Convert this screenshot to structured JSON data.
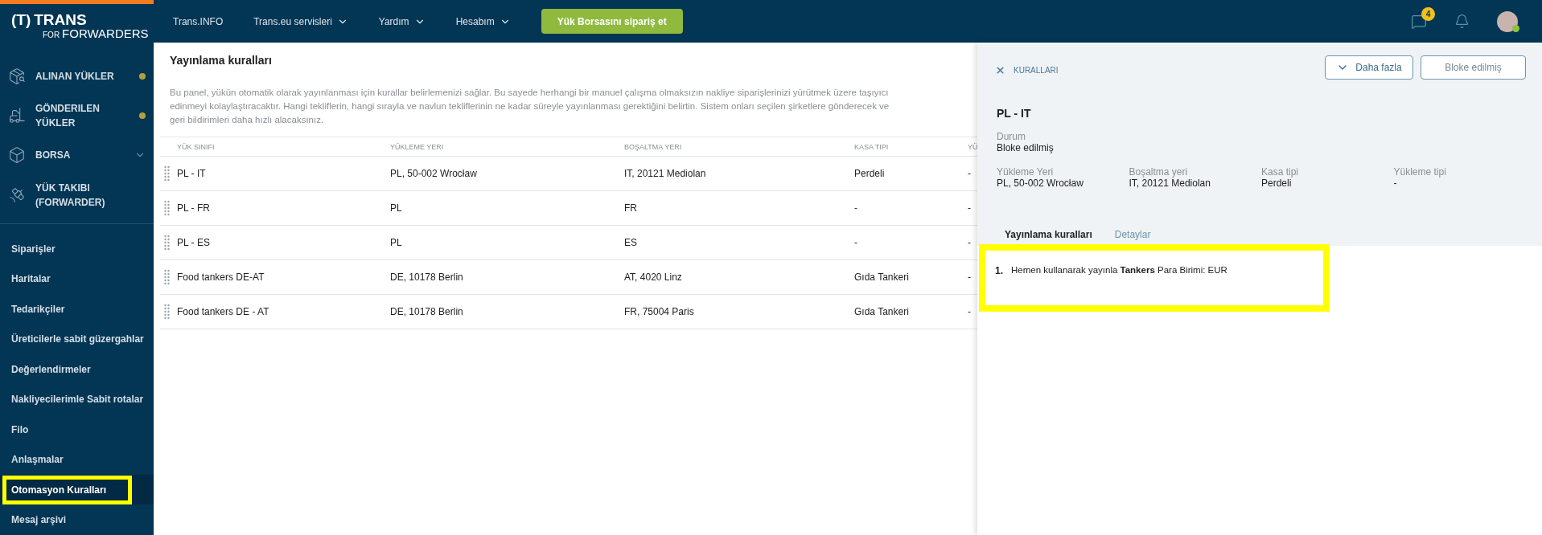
{
  "logo": {
    "mark": "(T)",
    "name": "TRANS",
    "prefix": "FOR",
    "tagline": "FORWARDERS"
  },
  "top_nav": [
    {
      "label": "Trans.INFO",
      "dropdown": false
    },
    {
      "label": "Trans.eu servisleri",
      "dropdown": true
    },
    {
      "label": "Yardım",
      "dropdown": true
    },
    {
      "label": "Hesabım",
      "dropdown": true
    }
  ],
  "order_button": "Yük Borsasını sipariş et",
  "messages_badge": "4",
  "sidebar": {
    "modules": [
      {
        "label": "ALINAN YÜKLER",
        "indicator": true,
        "dropdown": false
      },
      {
        "label": "GÖNDERILEN YÜKLER",
        "indicator": true,
        "dropdown": false
      },
      {
        "label": "BORSA",
        "indicator": false,
        "dropdown": true
      },
      {
        "label": "YÜK TAKIBI (FORWARDER)",
        "indicator": false,
        "dropdown": false
      }
    ],
    "links": [
      {
        "label": "Siparişler",
        "selected": false,
        "highlighted": false
      },
      {
        "label": "Haritalar",
        "selected": false,
        "highlighted": false
      },
      {
        "label": "Tedarikçiler",
        "selected": false,
        "highlighted": false
      },
      {
        "label": "Üreticilerle sabit güzergahlar",
        "selected": false,
        "highlighted": false
      },
      {
        "label": "Değerlendirmeler",
        "selected": false,
        "highlighted": false
      },
      {
        "label": "Nakliyecilerimle Sabit rotalar",
        "selected": false,
        "highlighted": false
      },
      {
        "label": "Filo",
        "selected": false,
        "highlighted": false
      },
      {
        "label": "Anlaşmalar",
        "selected": false,
        "highlighted": false
      },
      {
        "label": "Otomasyon Kuralları",
        "selected": true,
        "highlighted": true
      },
      {
        "label": "Mesaj arşivi",
        "selected": false,
        "highlighted": false
      }
    ]
  },
  "main": {
    "title": "Yayınlama kuralları",
    "description": "Bu panel, yükün otomatik olarak yayınlanması için kurallar belirlemenizi sağlar. Bu sayede herhangi bir manuel çalışma olmaksızın nakliye siparişlerinizi yürütmek üzere taşıyıcı edinmeyi kolaylaştıracaktır. Hangi tekliflerin, hangi sırayla ve navlun tekliflerinin ne kadar süreyle yayınlanması gerektiğini belirtin. Sistem onları seçilen şirketlere gönderecek ve geri bildirimleri daha hızlı alacaksınız.",
    "table": {
      "columns": [
        "YÜK SINIFI",
        "YÜKLEME YERI",
        "BOŞALTMA YERI",
        "KASA TIPI",
        "YÜ"
      ],
      "rows": [
        {
          "cells": [
            "PL - IT",
            "PL, 50-002 Wrocław",
            "IT, 20121 Mediolan",
            "Perdeli",
            "-"
          ]
        },
        {
          "cells": [
            "PL - FR",
            "PL",
            "FR",
            "-",
            "-"
          ]
        },
        {
          "cells": [
            "PL - ES",
            "PL",
            "ES",
            "-",
            "-"
          ]
        },
        {
          "cells": [
            "Food tankers DE-AT",
            "DE, 10178 Berlin",
            "AT, 4020 Linz",
            "Gıda Tankeri",
            "-"
          ]
        },
        {
          "cells": [
            "Food tankers DE - AT",
            "DE, 10178 Berlin",
            "FR, 75004 Paris",
            "Gıda Tankeri",
            "-"
          ]
        }
      ]
    }
  },
  "panel": {
    "close_label": "KURALLARI",
    "buttons": [
      {
        "label": "Daha fazla",
        "kind": "dropdown"
      },
      {
        "label": "Bloke edilmiş",
        "kind": "plain"
      }
    ],
    "title": "PL - IT",
    "status": {
      "label": "Durum",
      "value": "Bloke edilmiş"
    },
    "fields": [
      {
        "label": "Yükleme Yeri",
        "value": "PL, 50-002 Wrocław"
      },
      {
        "label": "Boşaltma yeri",
        "value": "IT, 20121 Mediolan"
      },
      {
        "label": "Kasa tipi",
        "value": "Perdeli"
      },
      {
        "label": "Yükleme tipi",
        "value": "-"
      }
    ],
    "tabs": [
      {
        "label": "Yayınlama kuralları",
        "selected": true
      },
      {
        "label": "Detaylar",
        "selected": false
      }
    ],
    "rules_highlighted": true,
    "rules": [
      {
        "number": "1.",
        "text": "Hemen kullanarak yayınla **Tankers** Para Birimi: EUR"
      }
    ]
  }
}
